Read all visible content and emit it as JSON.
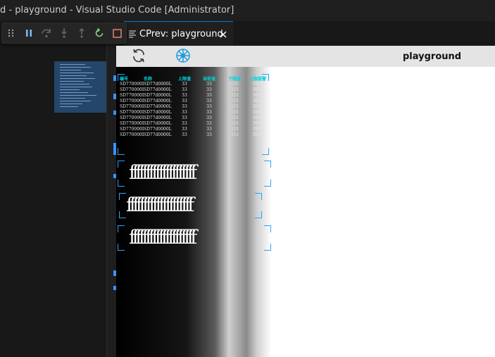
{
  "window": {
    "title": "d - playground - Visual Studio Code [Administrator]"
  },
  "debug_toolbar": {
    "icons": [
      "gripper-icon",
      "pause-icon",
      "step-over-icon",
      "step-into-icon",
      "step-out-icon",
      "restart-icon",
      "stop-icon"
    ]
  },
  "tab": {
    "label": "CPrev: playground"
  },
  "preview": {
    "title": "playground",
    "table": {
      "headers": [
        "编号",
        "名称",
        "上限值",
        "当前值",
        "下限值",
        "上限报警"
      ],
      "rows": [
        [
          "SD770000L",
          "SD77d0000L",
          "33",
          "33",
          "333",
          "BBB"
        ],
        [
          "SD770000L",
          "SD77d0000L",
          "33",
          "33",
          "333",
          "BBB"
        ],
        [
          "SD770000L",
          "SD77d0000L",
          "33",
          "33",
          "333",
          "BBB"
        ],
        [
          "SD770000L",
          "SD77d0000L",
          "33",
          "33",
          "333",
          "BBB"
        ],
        [
          "SD770000L",
          "SD77d0000L",
          "33",
          "33",
          "333",
          "BBB"
        ],
        [
          "SD770000L",
          "SD77d0000L",
          "33",
          "33",
          "333",
          "BBB"
        ],
        [
          "SD770000L",
          "SD77d0000L",
          "33",
          "33",
          "333",
          "BBB"
        ],
        [
          "SD770000L",
          "SD77d0000L",
          "33",
          "33",
          "333",
          "BBB"
        ],
        [
          "SD770000L",
          "SD77d0000L",
          "33",
          "33",
          "333",
          "BBB"
        ],
        [
          "SD770000L",
          "SD77d0000L",
          "33",
          "33",
          "333",
          "BBB"
        ]
      ]
    },
    "texts": [
      "ffffffffffffffffffff",
      "ffffffffffffffffffff",
      "ffffffffffffffffffff"
    ]
  },
  "colors": {
    "accent": "#29a3ff",
    "header_cyan": "#00d6e0",
    "restart_green": "#89d185",
    "stop_red": "#f48771",
    "debug_blue": "#75beff"
  }
}
